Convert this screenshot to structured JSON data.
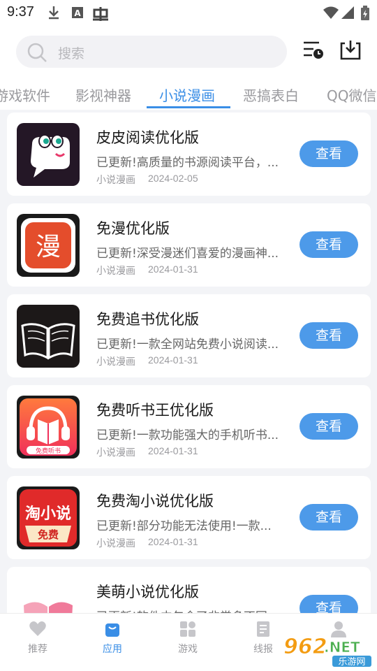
{
  "status_bar": {
    "time": "9:37",
    "left_icons": [
      "download-icon",
      "a-box-icon",
      "bug-icon"
    ],
    "right_icons": [
      "wifi-icon",
      "signal-icon",
      "battery-charging-icon"
    ]
  },
  "search": {
    "placeholder": "搜索"
  },
  "toolbar": {
    "icons": [
      "history-list-icon",
      "download-tray-icon"
    ]
  },
  "tabs": [
    {
      "label": "游戏软件",
      "active": false
    },
    {
      "label": "影视神器",
      "active": false
    },
    {
      "label": "小说漫画",
      "active": true
    },
    {
      "label": "恶搞表白",
      "active": false
    },
    {
      "label": "QQ微信",
      "active": false
    }
  ],
  "apps": [
    {
      "title": "皮皮阅读优化版",
      "desc": "已更新!高质量的书源阅读平台，...",
      "category": "小说漫画",
      "date": "2024-02-05",
      "button": "查看",
      "icon": "pipi-reader-icon"
    },
    {
      "title": "免漫优化版",
      "desc": "已更新!深受漫迷们喜爱的漫画神...",
      "category": "小说漫画",
      "date": "2024-01-31",
      "button": "查看",
      "icon": "mianman-icon",
      "icon_text": "漫"
    },
    {
      "title": "免费追书优化版",
      "desc": "已更新!一款全网站免费小说阅读...",
      "category": "小说漫画",
      "date": "2024-01-31",
      "button": "查看",
      "icon": "open-book-icon"
    },
    {
      "title": "免费听书王优化版",
      "desc": "已更新!一款功能强大的手机听书...",
      "category": "小说漫画",
      "date": "2024-01-31",
      "button": "查看",
      "icon": "audiobook-icon",
      "icon_text": "免费听书"
    },
    {
      "title": "免费淘小说优化版",
      "desc": "已更新!部分功能无法使用!一款...",
      "category": "小说漫画",
      "date": "2024-01-31",
      "button": "查看",
      "icon": "taoxiaoshuo-icon",
      "icon_text": "淘小说",
      "icon_sub": "免费"
    },
    {
      "title": "美萌小说优化版",
      "desc": "已更新!软件中包含了非常多不同",
      "category": "",
      "date": "",
      "button": "查看",
      "icon": "pink-book-icon"
    }
  ],
  "bottom_nav": [
    {
      "label": "推荐",
      "icon": "heart-icon",
      "active": false
    },
    {
      "label": "应用",
      "icon": "bag-icon",
      "active": true
    },
    {
      "label": "游戏",
      "icon": "grid-icon",
      "active": false
    },
    {
      "label": "线报",
      "icon": "document-icon",
      "active": false
    },
    {
      "label": "",
      "icon": "person-icon",
      "active": false
    }
  ],
  "watermark": {
    "number": "962",
    "suffix": ".NET",
    "sub": "乐游网"
  },
  "colors": {
    "accent": "#3a8ee6",
    "button": "#4d9ae9",
    "list_bg": "#f3f4f7"
  }
}
